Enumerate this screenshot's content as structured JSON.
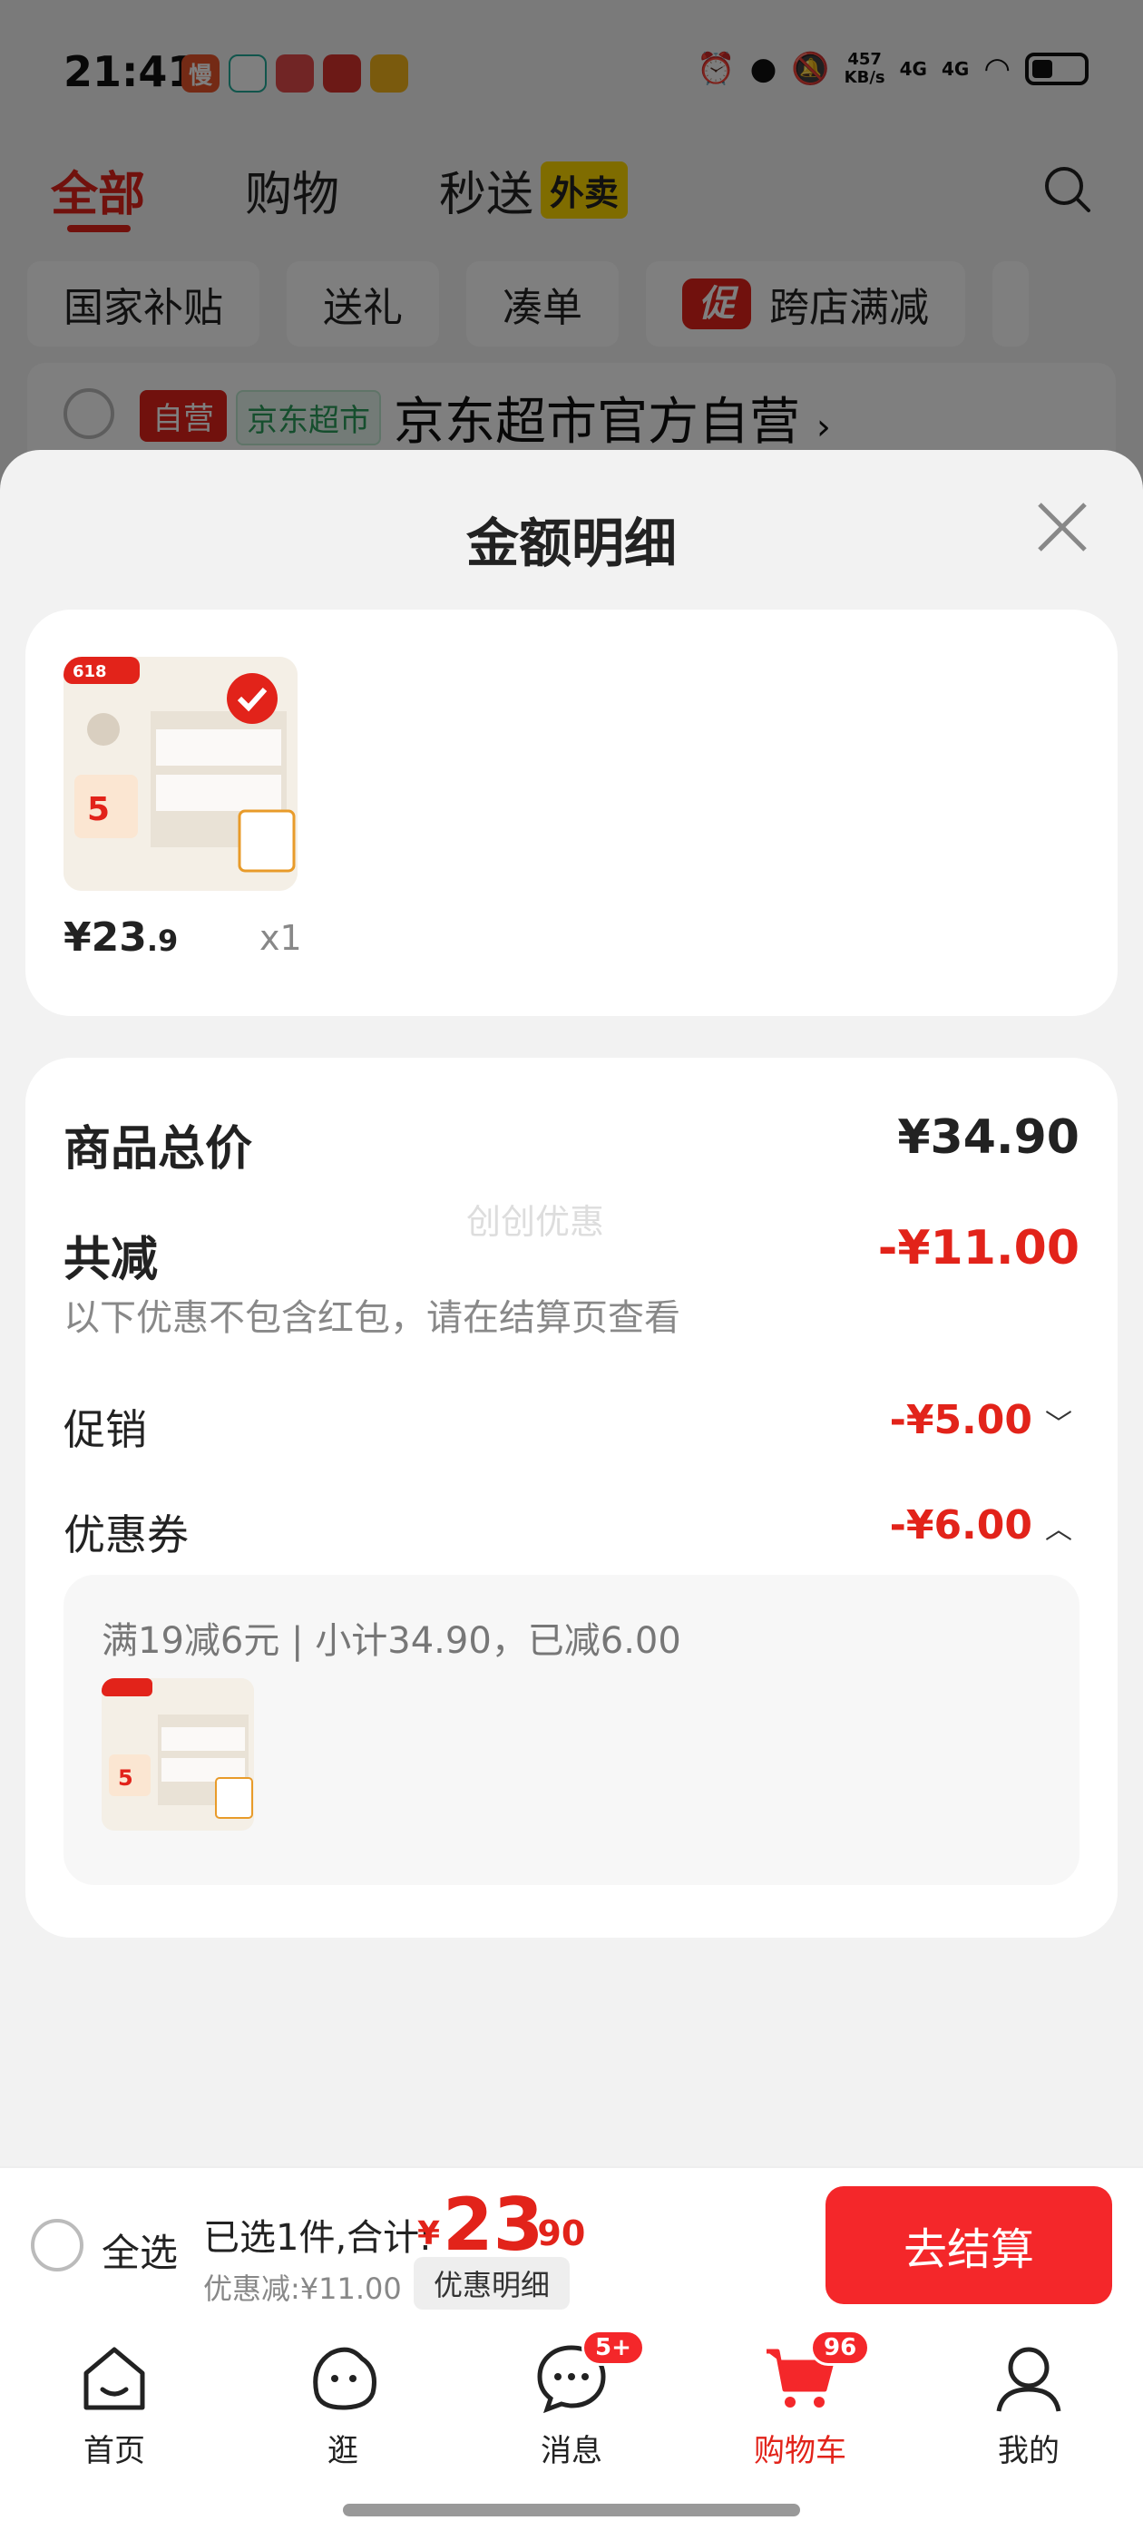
{
  "status": {
    "time": "21:41",
    "speed": "457",
    "speed_unit": "KB/s",
    "net1": "4G",
    "net2": "4G"
  },
  "top_tabs": [
    {
      "label": "全部"
    },
    {
      "label": "购物"
    },
    {
      "label": "秒送",
      "badge": "外卖"
    }
  ],
  "chips": [
    "国家补贴",
    "送礼",
    "凑单",
    "跨店满减"
  ],
  "promo_tag": "促",
  "store": {
    "tag_self": "自营",
    "tag_market": "京东超市",
    "name": "京东超市官方自营",
    "arrow": "›"
  },
  "sheet": {
    "title": "金额明细",
    "product": {
      "price_int": "¥23",
      "price_dec": ".9",
      "qty": "x1"
    },
    "total_label": "商品总价",
    "total_value": "¥34.90",
    "reduce_label": "共减",
    "reduce_value": "-¥11.00",
    "note": "以下优惠不包含红包，请在结算页查看",
    "watermark": "创创优惠",
    "promo_label": "促销",
    "promo_value": "-¥5.00",
    "coupon_label": "优惠券",
    "coupon_value": "-¥6.00",
    "coupon_detail": "满19减6元 | 小计34.90，已减6.00"
  },
  "checkout": {
    "select_all": "全选",
    "summary_label": "已选1件,合计:",
    "yen": "¥",
    "sum_int": "23",
    "sum_dec": ".90",
    "discount_label": "优惠减:¥11.00",
    "detail_button": "优惠明细",
    "checkout_button": "去结算"
  },
  "nav": [
    {
      "label": "首页"
    },
    {
      "label": "逛"
    },
    {
      "label": "消息",
      "badge": "5+"
    },
    {
      "label": "购物车",
      "badge": "96"
    },
    {
      "label": "我的"
    }
  ],
  "colors": {
    "accent": "#e2231a",
    "button": "#f4272a"
  }
}
